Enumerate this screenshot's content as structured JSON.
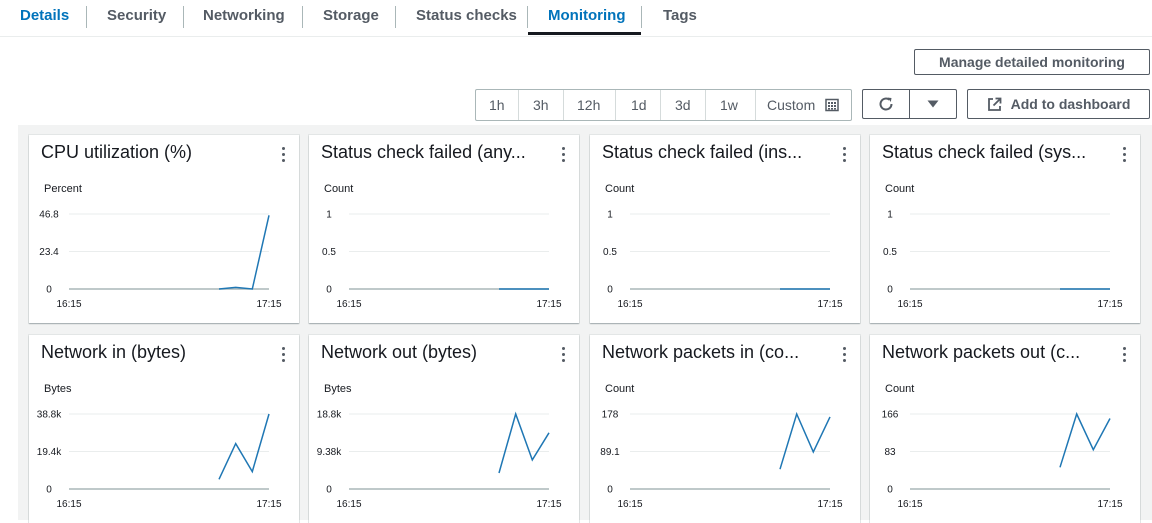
{
  "tabs": [
    {
      "label": "Details"
    },
    {
      "label": "Security"
    },
    {
      "label": "Networking"
    },
    {
      "label": "Storage"
    },
    {
      "label": "Status checks"
    },
    {
      "label": "Monitoring"
    },
    {
      "label": "Tags"
    }
  ],
  "active_tab": "Monitoring",
  "actions": {
    "manage_label": "Manage detailed monitoring",
    "add_dashboard_label": "Add to dashboard"
  },
  "time_ranges": [
    "1h",
    "3h",
    "12h",
    "1d",
    "3d",
    "1w",
    "Custom"
  ],
  "colors": {
    "accent": "#0073bb",
    "series": "#1f77b4",
    "axis": "#aab7b8",
    "grid": "#eaeded"
  },
  "chart_data": [
    {
      "type": "line",
      "title": "CPU utilization (%)",
      "ylabel": "Percent",
      "yticks": [
        "46.8",
        "23.4",
        "0"
      ],
      "ylim": [
        0,
        46.8
      ],
      "xticks": [
        "16:15",
        "17:15"
      ],
      "x": [
        "17:00",
        "17:05",
        "17:10",
        "17:15"
      ],
      "series": [
        {
          "values": [
            0,
            1,
            0,
            46
          ]
        }
      ]
    },
    {
      "type": "line",
      "title": "Status check failed (any...",
      "ylabel": "Count",
      "yticks": [
        "1",
        "0.5",
        "0"
      ],
      "ylim": [
        0,
        1
      ],
      "xticks": [
        "16:15",
        "17:15"
      ],
      "x": [
        "17:00",
        "17:05",
        "17:10",
        "17:15"
      ],
      "series": [
        {
          "values": [
            0,
            0,
            0,
            0
          ]
        }
      ]
    },
    {
      "type": "line",
      "title": "Status check failed (ins...",
      "ylabel": "Count",
      "yticks": [
        "1",
        "0.5",
        "0"
      ],
      "ylim": [
        0,
        1
      ],
      "xticks": [
        "16:15",
        "17:15"
      ],
      "x": [
        "17:00",
        "17:05",
        "17:10",
        "17:15"
      ],
      "series": [
        {
          "values": [
            0,
            0,
            0,
            0
          ]
        }
      ]
    },
    {
      "type": "line",
      "title": "Status check failed (sys...",
      "ylabel": "Count",
      "yticks": [
        "1",
        "0.5",
        "0"
      ],
      "ylim": [
        0,
        1
      ],
      "xticks": [
        "16:15",
        "17:15"
      ],
      "x": [
        "17:00",
        "17:05",
        "17:10",
        "17:15"
      ],
      "series": [
        {
          "values": [
            0,
            0,
            0,
            0
          ]
        }
      ]
    },
    {
      "type": "line",
      "title": "Network in (bytes)",
      "ylabel": "Bytes",
      "yticks": [
        "38.8k",
        "19.4k",
        "0"
      ],
      "ylim": [
        0,
        38800
      ],
      "xticks": [
        "16:15",
        "17:15"
      ],
      "x": [
        "17:00",
        "17:05",
        "17:10",
        "17:15"
      ],
      "series": [
        {
          "values": [
            5000,
            23500,
            9000,
            38800
          ]
        }
      ]
    },
    {
      "type": "line",
      "title": "Network out (bytes)",
      "ylabel": "Bytes",
      "yticks": [
        "18.8k",
        "9.38k",
        "0"
      ],
      "ylim": [
        0,
        18800
      ],
      "xticks": [
        "16:15",
        "17:15"
      ],
      "x": [
        "17:00",
        "17:05",
        "17:10",
        "17:15"
      ],
      "series": [
        {
          "values": [
            4000,
            18800,
            7300,
            14100
          ]
        }
      ]
    },
    {
      "type": "line",
      "title": "Network packets in (co...",
      "ylabel": "Count",
      "yticks": [
        "178",
        "89.1",
        "0"
      ],
      "ylim": [
        0,
        178
      ],
      "xticks": [
        "16:15",
        "17:15"
      ],
      "x": [
        "17:00",
        "17:05",
        "17:10",
        "17:15"
      ],
      "series": [
        {
          "values": [
            47,
            178,
            88,
            171
          ]
        }
      ]
    },
    {
      "type": "line",
      "title": "Network packets out (c...",
      "ylabel": "Count",
      "yticks": [
        "166",
        "83",
        "0"
      ],
      "ylim": [
        0,
        166
      ],
      "xticks": [
        "16:15",
        "17:15"
      ],
      "x": [
        "17:00",
        "17:05",
        "17:10",
        "17:15"
      ],
      "series": [
        {
          "values": [
            48,
            166,
            87,
            156
          ]
        }
      ]
    }
  ]
}
